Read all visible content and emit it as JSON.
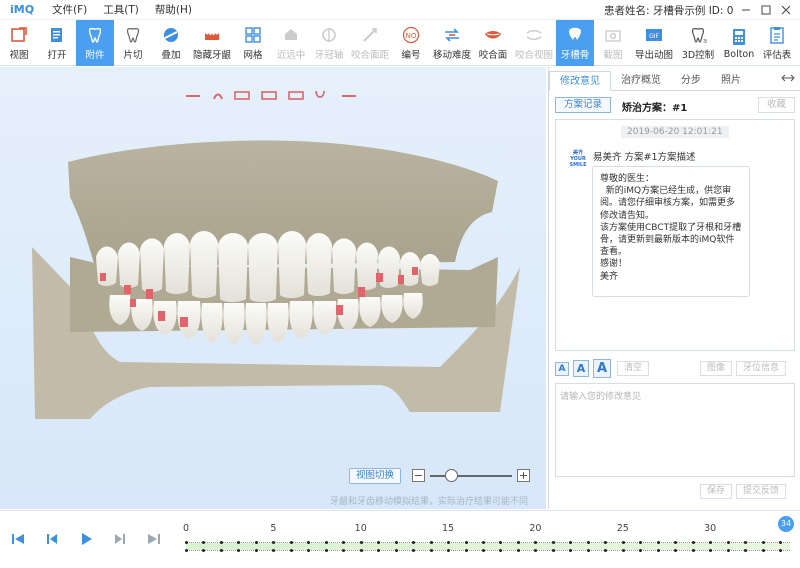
{
  "app": {
    "name": "iMQ"
  },
  "menu": [
    {
      "label": "文件(F)"
    },
    {
      "label": "工具(T)"
    },
    {
      "label": "帮助(H)"
    }
  ],
  "patient": {
    "label": "患者姓名: 牙槽骨示例 ID: 0"
  },
  "toolbar": [
    {
      "label": "视图",
      "icon": "view-icon",
      "disabled": false,
      "active": false
    },
    {
      "label": "打开",
      "icon": "open-icon",
      "disabled": false,
      "active": false
    },
    {
      "label": "附件",
      "icon": "attachment-tooth-icon",
      "disabled": false,
      "active": true
    },
    {
      "label": "片切",
      "icon": "ipr-icon",
      "disabled": false,
      "active": false
    },
    {
      "label": "叠加",
      "icon": "overlay-icon",
      "disabled": false,
      "active": false
    },
    {
      "label": "隐藏牙龈",
      "icon": "hide-gum-icon",
      "disabled": false,
      "active": false
    },
    {
      "label": "网格",
      "icon": "grid-icon",
      "disabled": false,
      "active": false
    },
    {
      "label": "近远中",
      "icon": "mesiodistal-icon",
      "disabled": true,
      "active": false
    },
    {
      "label": "牙冠轴",
      "icon": "crown-axis-icon",
      "disabled": true,
      "active": false
    },
    {
      "label": "咬合面距",
      "icon": "occlusal-distance-icon",
      "disabled": true,
      "active": false
    },
    {
      "label": "编号",
      "icon": "number-icon",
      "disabled": false,
      "active": false
    },
    {
      "label": "移动难度",
      "icon": "movement-difficulty-icon",
      "disabled": false,
      "active": false
    },
    {
      "label": "咬合面",
      "icon": "occlusal-icon",
      "disabled": false,
      "active": false
    },
    {
      "label": "咬合视图",
      "icon": "bite-view-icon",
      "disabled": true,
      "active": false
    },
    {
      "label": "牙槽骨",
      "icon": "alveolar-bone-icon",
      "disabled": false,
      "active": true
    },
    {
      "label": "截图",
      "icon": "screenshot-icon",
      "disabled": true,
      "active": false
    },
    {
      "label": "导出动图",
      "icon": "export-gif-icon",
      "disabled": false,
      "active": false
    },
    {
      "label": "3D控制",
      "icon": "3d-control-icon",
      "disabled": false,
      "active": false
    },
    {
      "label": "Bolton",
      "icon": "bolton-icon",
      "disabled": false,
      "active": false
    },
    {
      "label": "评估表",
      "icon": "evaluation-icon",
      "disabled": false,
      "active": false
    }
  ],
  "viewport": {
    "view_switch_label": "视图切换",
    "disclaimer": "牙龈和牙齿移动模拟结果，实际治疗结果可能不同"
  },
  "panel": {
    "tabs": [
      {
        "label": "修改意见",
        "active": true
      },
      {
        "label": "治疗概览",
        "active": false
      },
      {
        "label": "分步",
        "active": false
      },
      {
        "label": "照片",
        "active": false
      }
    ],
    "plan_record_button": "方案记录",
    "plan_title": "矫治方案：#1",
    "collect_button": "收藏",
    "message": {
      "timestamp": "2019-06-20 12:01:21",
      "avatar_text": "美齐 YOUR SMILE",
      "sender": "易美齐  方案#1方案描述",
      "lines": [
        "尊敬的医生：",
        "  新的iMQ方案已经生成，供您审",
        "阅。请您仔细审核方案，如需更多",
        "修改请告知。",
        "该方案使用CBCT提取了牙根和牙槽",
        "骨，请更新到最新版本的iMQ软件",
        "查看。",
        "感谢！",
        "美齐"
      ]
    },
    "format_buttons": [
      "A",
      "A",
      "A"
    ],
    "clear_button": "清空",
    "insert_buttons": [
      "图像",
      "牙位信息"
    ],
    "input_placeholder": "请输入您的修改意见",
    "save_button": "保存",
    "submit_button": "提交反馈"
  },
  "timeline": {
    "tick_labels": [
      "0",
      "5",
      "10",
      "15",
      "20",
      "25",
      "30"
    ],
    "total_steps": 34,
    "current_step_badge": "34"
  }
}
